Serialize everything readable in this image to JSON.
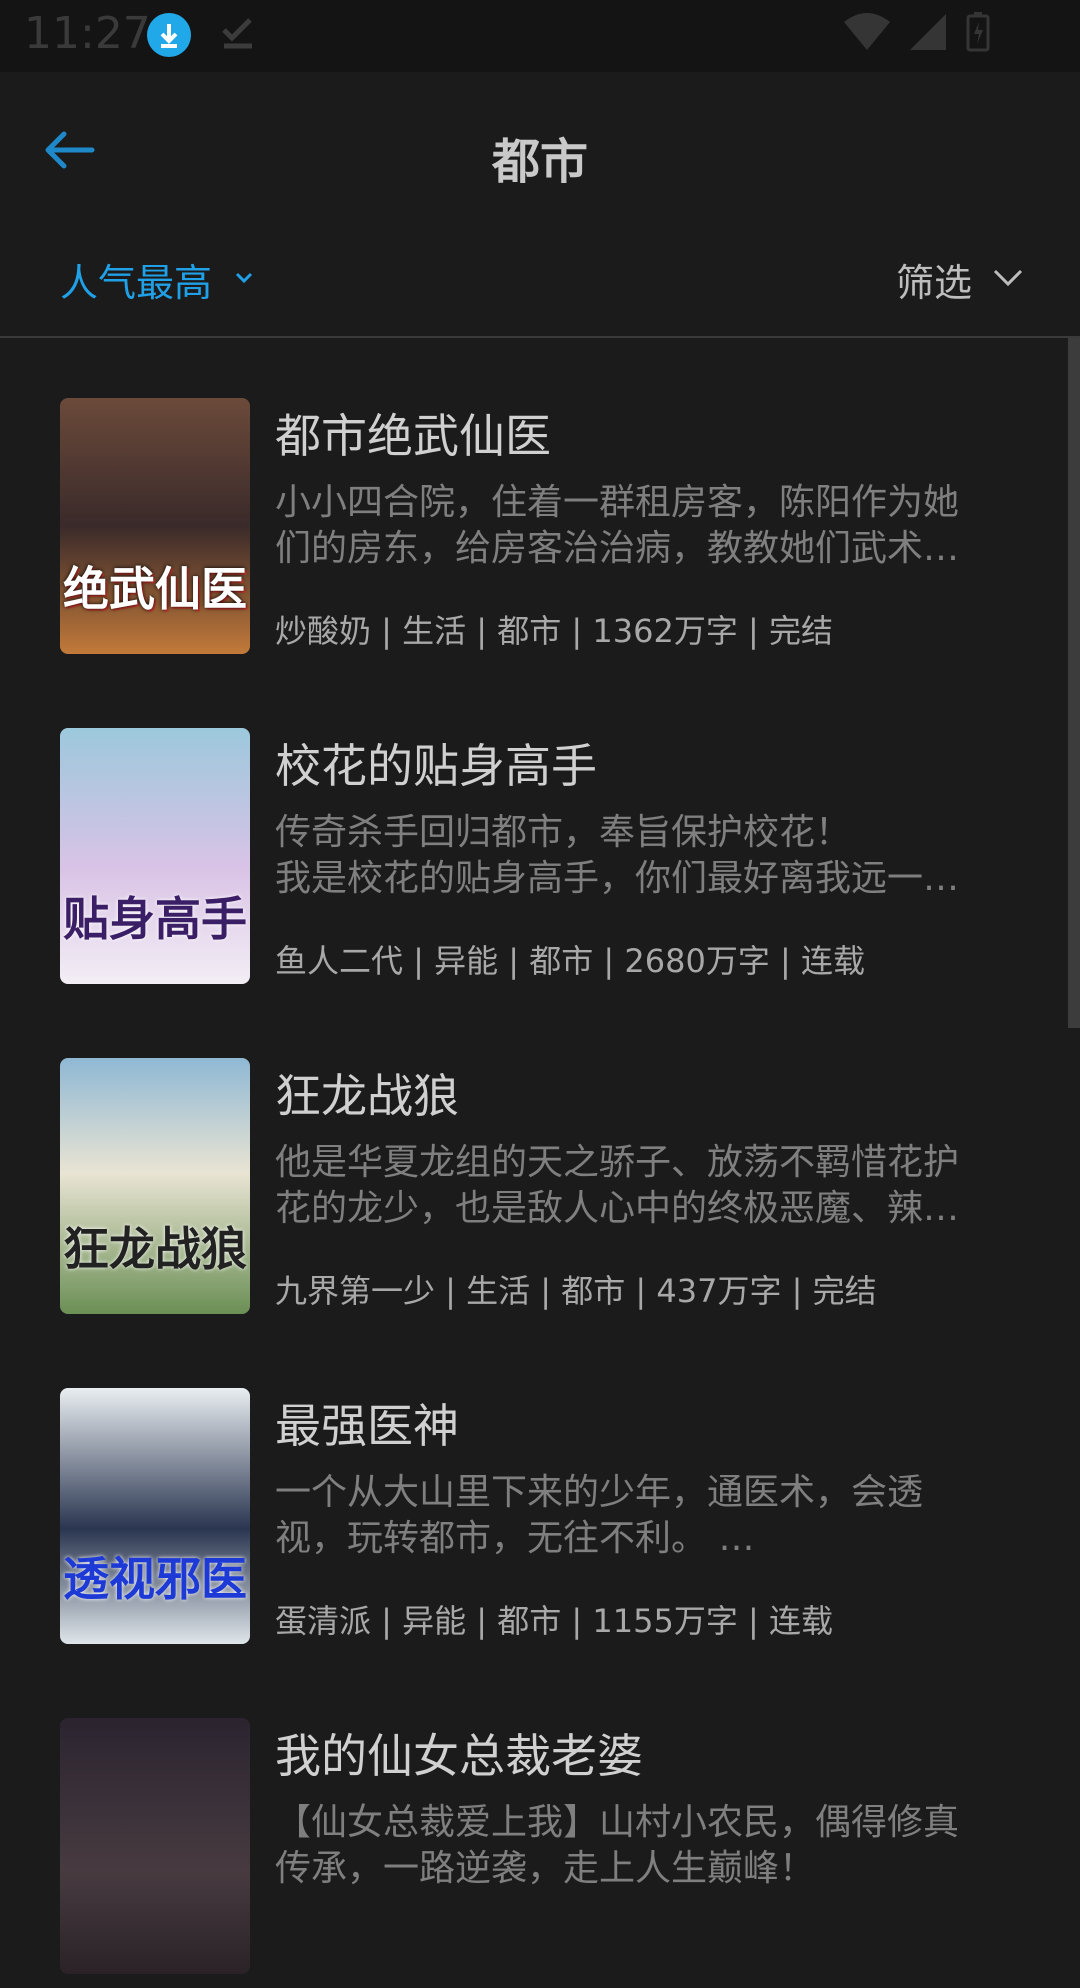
{
  "status": {
    "time": "11:27"
  },
  "header": {
    "title": "都市"
  },
  "filters": {
    "sort_label": "人气最高",
    "filter_label": "筛选"
  },
  "books": [
    {
      "title": "都市绝武仙医",
      "desc_line1": "小小四合院，住着一群租房客，陈阳作为她",
      "desc_line2": "们的房东，给房客治治病，教教她们武术…",
      "meta": "炒酸奶 | 生活 | 都市 | 1362万字 | 完结",
      "cover_text": "绝武仙医",
      "cover_colors": [
        "#6b4a3a",
        "#c27a3a"
      ]
    },
    {
      "title": "校花的贴身高手",
      "desc_line1": "传奇杀手回归都市，奉旨保护校花！",
      "desc_line2": "我是校花的贴身高手，你们最好离我远一…",
      "meta": "鱼人二代 | 异能 | 都市 | 2680万字 | 连载",
      "cover_text": "贴身高手",
      "cover_colors": [
        "#7fb3c8",
        "#b48bcf"
      ]
    },
    {
      "title": "狂龙战狼",
      "desc_line1": "他是华夏龙组的天之骄子、放荡不羁惜花护",
      "desc_line2": "花的龙少，也是敌人心中的终极恶魔、辣…",
      "meta": "九界第一少 | 生活 | 都市 | 437万字 | 完结",
      "cover_text": "狂龙战狼",
      "cover_colors": [
        "#8fb8d4",
        "#5d7a4a"
      ]
    },
    {
      "title": "最强医神",
      "desc_line1": "一个从大山里下来的少年，通医术，会透",
      "desc_line2": "视，玩转都市，无往不利。 …",
      "meta": "蛋清派 | 异能 | 都市 | 1155万字 | 连载",
      "cover_text": "透视邪医",
      "cover_colors": [
        "#d9e4ea",
        "#2a3550"
      ]
    },
    {
      "title": "我的仙女总裁老婆",
      "desc_line1": "【仙女总裁爱上我】山村小农民，偶得修真",
      "desc_line2": "传承，一路逆袭，走上人生巅峰！",
      "meta": "",
      "cover_text": "",
      "cover_colors": [
        "#2b2430",
        "#4a3a3a"
      ]
    }
  ]
}
